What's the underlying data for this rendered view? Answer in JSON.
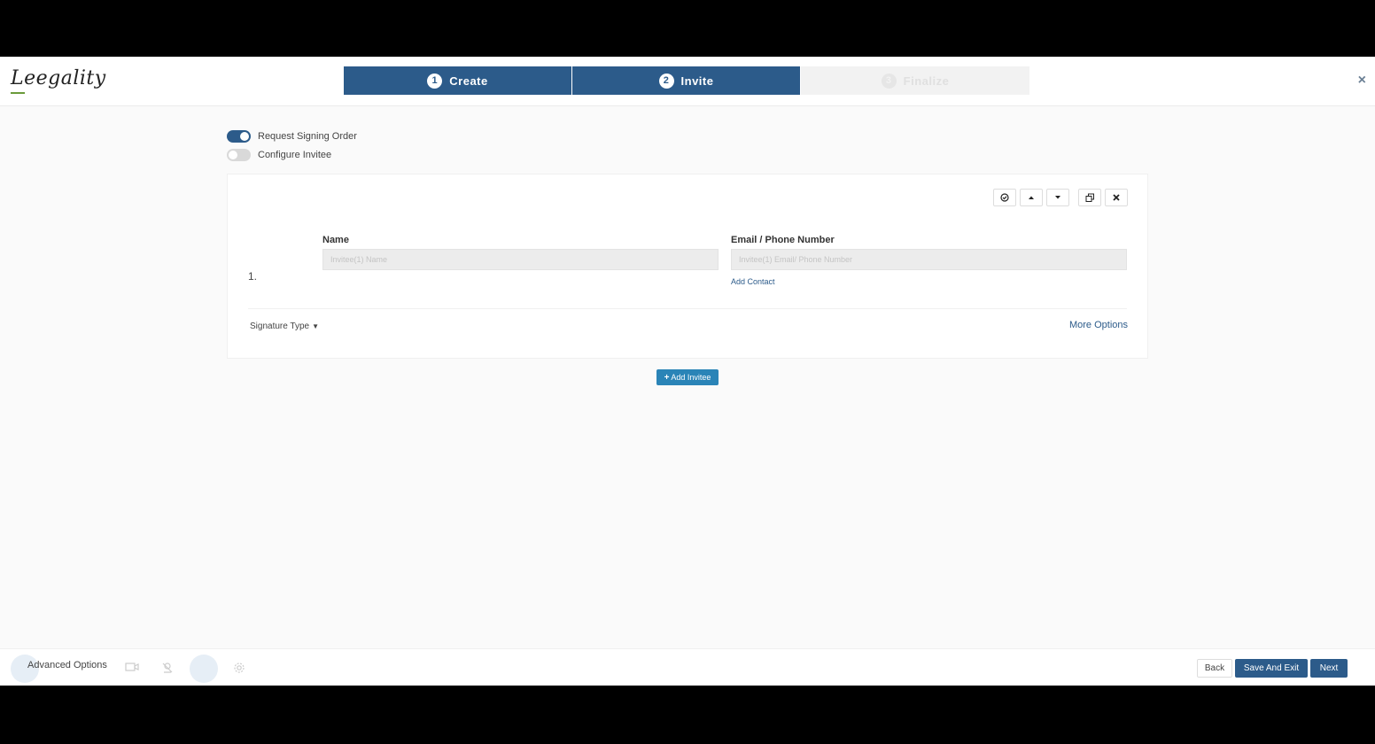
{
  "header": {
    "logo_text": "Leegality",
    "steps": [
      {
        "num": "1",
        "label": "Create"
      },
      {
        "num": "2",
        "label": "Invite"
      },
      {
        "num": "3",
        "label": "Finalize"
      }
    ],
    "close_icon": "×"
  },
  "options": {
    "signing_order_label": "Request Signing Order",
    "configure_invitee_label": "Configure Invitee"
  },
  "invitee": {
    "index": "1.",
    "name_label": "Name",
    "name_placeholder": "Invitee(1) Name",
    "email_label": "Email / Phone Number",
    "email_placeholder": "Invitee(1) Email/ Phone Number",
    "add_contact": "Add Contact",
    "signature_type": "Signature Type",
    "more_options": "More Options"
  },
  "add_invitee_label": "Add Invitee",
  "footer": {
    "advanced_options": "Advanced Options",
    "back": "Back",
    "save_and_exit": "Save And Exit",
    "next": "Next"
  },
  "colors": {
    "primary": "#2c5b8a",
    "accent": "#2a84b7"
  }
}
